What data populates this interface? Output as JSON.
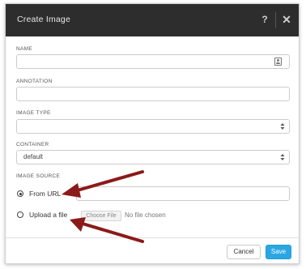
{
  "dialog": {
    "title": "Create Image",
    "help_symbol": "?",
    "close_symbol": "✕"
  },
  "form": {
    "name": {
      "label": "NAME",
      "value": ""
    },
    "annotation": {
      "label": "ANNOTATION",
      "value": ""
    },
    "image_type": {
      "label": "IMAGE TYPE",
      "value": ""
    },
    "container": {
      "label": "CONTAINER",
      "value": "default"
    },
    "image_source": {
      "label": "IMAGE SOURCE",
      "options": [
        {
          "label": "From URL",
          "selected": true
        },
        {
          "label": "Upload a file",
          "selected": false
        }
      ],
      "url_value": "",
      "file_button": "Choose File",
      "file_status": "No file chosen"
    }
  },
  "footer": {
    "cancel_label": "Cancel",
    "save_label": "Save"
  },
  "colors": {
    "header_bg": "#2d2d2d",
    "save_bg": "#2aa7e3",
    "annotation_arrow": "#8b1a1a"
  }
}
